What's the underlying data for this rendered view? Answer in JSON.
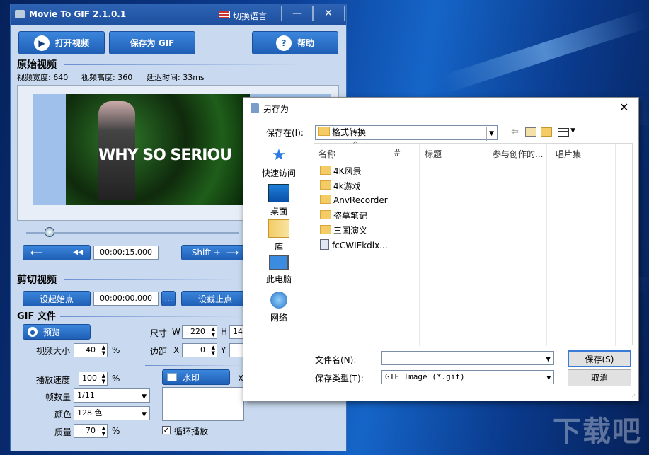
{
  "app": {
    "title": "Movie To GIF 2.1.0.1",
    "language_switch": "切换语言",
    "min": "—",
    "close": "✕",
    "open_video": "打开视频",
    "save_gif": "保存为 GIF",
    "help": "帮助",
    "help_icon": "?",
    "play_icon": "▶",
    "source_section": "原始视频",
    "video_width": "视频宽度: 640",
    "video_height": "视频高度: 360",
    "delay": "延迟时间: 33ms",
    "preview_caption": "WHY SO SERIOU",
    "prev_arrow": "⟵",
    "rewind_icon": "◀◀",
    "time_current": "00:00:15.000",
    "shift_label": "Shift +",
    "shift_arrow": "⟶",
    "cut_section": "剪切视频",
    "set_start": "设起始点",
    "start_time": "00:00:00.000",
    "ellipsis": "...",
    "set_end": "设截止点",
    "gif_section": "GIF 文件",
    "preview_btn": "预览",
    "video_size_label": "视频大小",
    "video_size_value": "40",
    "percent": "%",
    "size_label": "尺寸",
    "w_label": "W",
    "w_value": "220",
    "h_label": "H",
    "h_value": "14",
    "margin_label": "边距",
    "x_label": "X",
    "x_value": "0",
    "y_label": "Y",
    "speed_label": "播放速度",
    "speed_value": "100",
    "frames_label": "帧数量",
    "frames_value": "1/11",
    "color_label": "颜色",
    "color_value": "128 色",
    "quality_label": "质量",
    "quality_value": "70",
    "watermark_btn": "水印",
    "x_short": "X",
    "loop_label": "循环播放",
    "check_mark": "✓"
  },
  "dialog": {
    "title": "另存为",
    "close": "✕",
    "save_in_label": "保存在(I):",
    "save_in_value": "格式转换",
    "nav": [
      "快速访问",
      "桌面",
      "库",
      "此电脑",
      "网络"
    ],
    "columns": [
      "名称",
      "#",
      "标题",
      "参与创作的...",
      "唱片集"
    ],
    "files": [
      "4K风景",
      "4k游戏",
      "AnvRecorder",
      "盗墓笔记",
      "三国演义",
      "fcCWIEkdlx..."
    ],
    "filename_label": "文件名(N):",
    "filename_value": "",
    "filetype_label": "保存类型(T):",
    "filetype_value": "GIF Image (*.gif)",
    "save_btn": "保存(S)",
    "cancel_btn": "取消"
  },
  "desktop": {
    "watermark": "下载吧"
  }
}
